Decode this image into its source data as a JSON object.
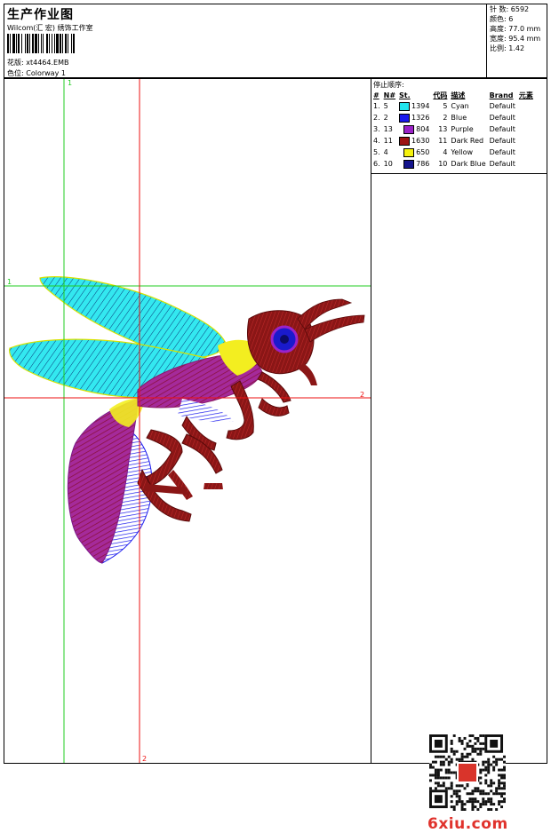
{
  "header": {
    "title": "生产作业图",
    "company": "Wilcom(汇 宏) 绣饰工作室",
    "design_label": "花版: xt4464.EMB",
    "colorway_label": "色位:  Colorway 1"
  },
  "info": {
    "stitches": "针 数: 6592",
    "colors": "颜色: 6",
    "height": "高度: 77.0 mm",
    "width": "宽度: 95.4 mm",
    "scale": "比例: 1.42"
  },
  "stops": {
    "title": "停止顺序:",
    "headers": [
      "#",
      "N#",
      "St.",
      "代码",
      "描述",
      "Brand",
      "元素"
    ],
    "rows": [
      {
        "idx": "1.",
        "n": "5",
        "color": "#22e6ee",
        "st": "1394",
        "code": "5",
        "desc": "Cyan",
        "brand": "Default"
      },
      {
        "idx": "2.",
        "n": "2",
        "color": "#1a1aee",
        "st": "1326",
        "code": "2",
        "desc": "Blue",
        "brand": "Default"
      },
      {
        "idx": "3.",
        "n": "13",
        "color": "#9b22c8",
        "st": "804",
        "code": "13",
        "desc": "Purple",
        "brand": "Default"
      },
      {
        "idx": "4.",
        "n": "11",
        "color": "#9c1212",
        "st": "1630",
        "code": "11",
        "desc": "Dark Red",
        "brand": "Default"
      },
      {
        "idx": "5.",
        "n": "4",
        "color": "#f5f20e",
        "st": "650",
        "code": "4",
        "desc": "Yellow",
        "brand": "Default"
      },
      {
        "idx": "6.",
        "n": "10",
        "color": "#14148c",
        "st": "786",
        "code": "10",
        "desc": "Dark Blue",
        "brand": "Default"
      }
    ]
  },
  "guides": {
    "v1": "1",
    "h1": "1",
    "h2": "2",
    "v2": "2"
  },
  "watermark": {
    "site": "6xiu.com"
  },
  "colors": {
    "grid_green": "#22cc22",
    "grid_red": "#ee1111"
  }
}
